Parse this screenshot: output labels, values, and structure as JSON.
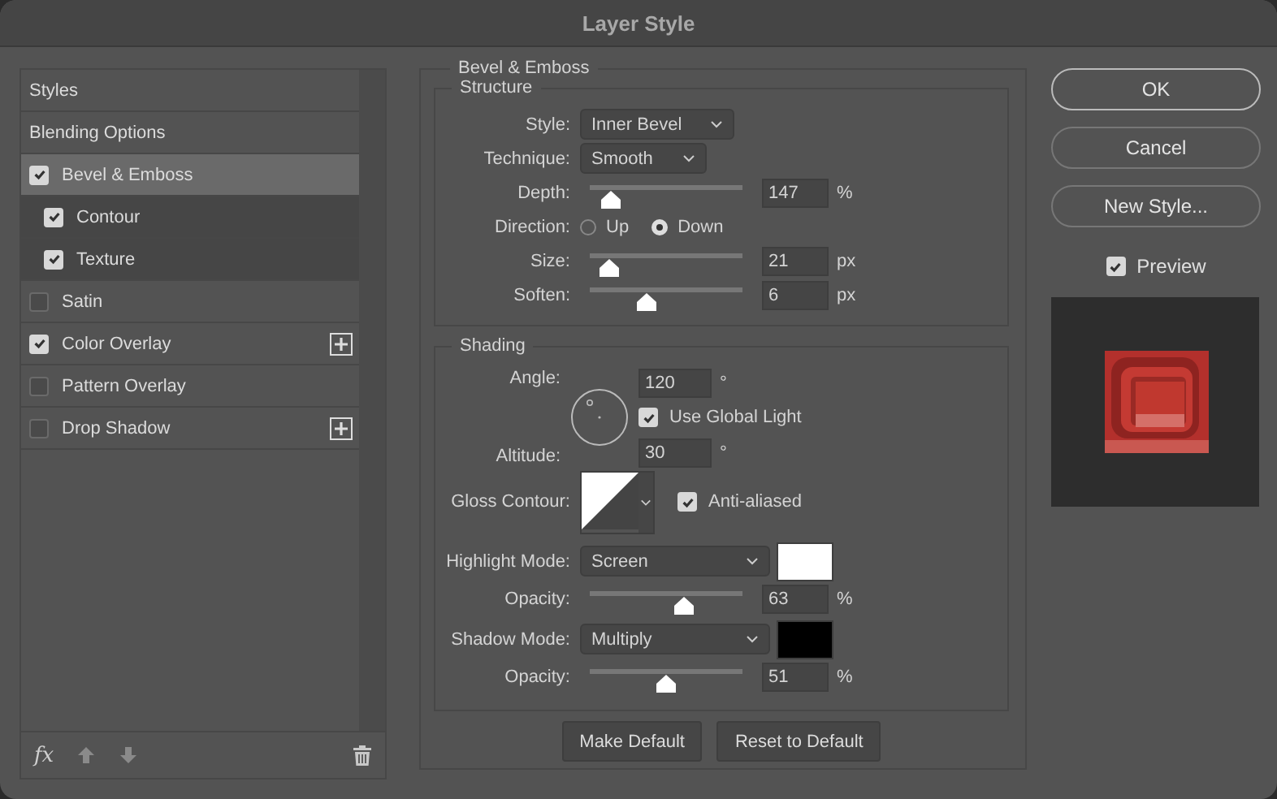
{
  "window": {
    "title": "Layer Style"
  },
  "styles_list": {
    "items": [
      {
        "label": "Styles",
        "kind": "section",
        "selected": false
      },
      {
        "label": "Blending Options",
        "kind": "section",
        "selected": false
      },
      {
        "label": "Bevel & Emboss",
        "kind": "effect",
        "checked": true,
        "selected": true,
        "addable": false,
        "children": [
          {
            "label": "Contour",
            "checked": true,
            "selected": false
          },
          {
            "label": "Texture",
            "checked": true,
            "selected": false
          }
        ]
      },
      {
        "label": "Satin",
        "kind": "effect",
        "checked": false,
        "selected": false,
        "addable": false
      },
      {
        "label": "Color Overlay",
        "kind": "effect",
        "checked": true,
        "selected": false,
        "addable": true
      },
      {
        "label": "Pattern Overlay",
        "kind": "effect",
        "checked": false,
        "selected": false,
        "addable": false
      },
      {
        "label": "Drop Shadow",
        "kind": "effect",
        "checked": false,
        "selected": false,
        "addable": true
      }
    ],
    "toolbar": {
      "fx": "fx"
    }
  },
  "panel": {
    "title": "Bevel & Emboss",
    "structure": {
      "title": "Structure",
      "rows": [
        {
          "kind": "select",
          "label": "Style:",
          "value": "Inner Bevel"
        },
        {
          "kind": "select",
          "label": "Technique:",
          "value": "Smooth"
        },
        {
          "kind": "slider",
          "label": "Depth:",
          "level": 0.14,
          "value": "147",
          "unit": "%"
        },
        {
          "kind": "radio",
          "label": "Direction:",
          "options": [
            {
              "label": "Up",
              "selected": false
            },
            {
              "label": "Down",
              "selected": true
            }
          ]
        },
        {
          "kind": "slider",
          "label": "Size:",
          "level": 0.13,
          "value": "21",
          "unit": "px"
        },
        {
          "kind": "slider",
          "label": "Soften:",
          "level": 0.37,
          "value": "6",
          "unit": "px"
        }
      ]
    },
    "shading": {
      "title": "Shading",
      "angle": {
        "label": "Angle:",
        "value": "120",
        "unit": "°"
      },
      "use_global_light": {
        "label": "Use Global Light",
        "checked": true
      },
      "altitude": {
        "label": "Altitude:",
        "value": "30",
        "unit": "°"
      },
      "gloss_contour": {
        "label": "Gloss Contour:"
      },
      "anti_aliased": {
        "label": "Anti-aliased",
        "checked": true
      },
      "modes": [
        {
          "label": "Highlight Mode:",
          "value": "Screen",
          "color": "#ffffff",
          "opacity": {
            "label": "Opacity:",
            "level": 0.62,
            "value": "63",
            "unit": "%"
          }
        },
        {
          "label": "Shadow Mode:",
          "value": "Multiply",
          "color": "#000000",
          "opacity": {
            "label": "Opacity:",
            "level": 0.5,
            "value": "51",
            "unit": "%"
          }
        }
      ]
    },
    "buttons": [
      "Make Default",
      "Reset to Default"
    ]
  },
  "actions": [
    {
      "label": "OK",
      "default": true
    },
    {
      "label": "Cancel",
      "default": false
    },
    {
      "label": "New Style...",
      "default": false
    }
  ],
  "preview": {
    "label": "Preview",
    "checked": true
  }
}
